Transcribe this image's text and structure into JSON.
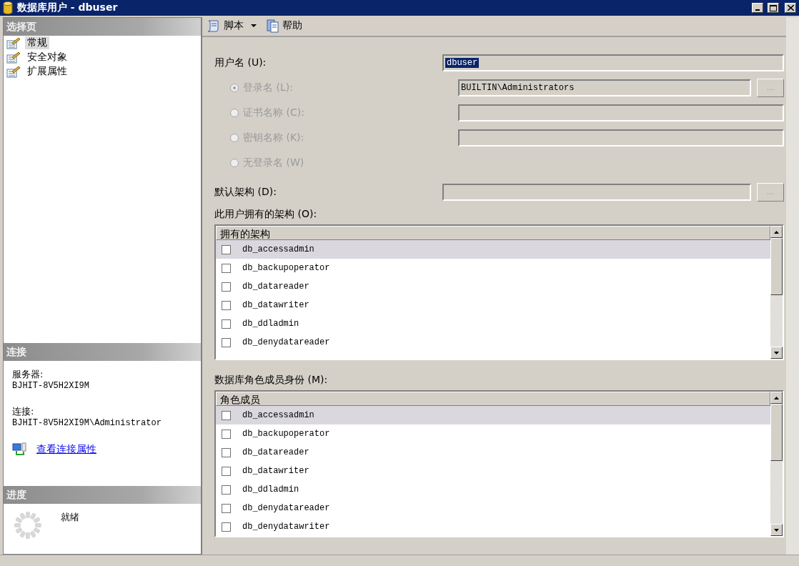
{
  "window": {
    "title": "数据库用户 - dbuser"
  },
  "sidebar": {
    "header": "选择页",
    "items": [
      {
        "label": "常规",
        "selected": true
      },
      {
        "label": "安全对象",
        "selected": false
      },
      {
        "label": "扩展属性",
        "selected": false
      }
    ]
  },
  "connection": {
    "header": "连接",
    "server_label": "服务器:",
    "server": "BJHIT-8V5H2XI9M",
    "connection_label": "连接:",
    "connection": "BJHIT-8V5H2XI9M\\Administrator",
    "link": "查看连接属性"
  },
  "progress": {
    "header": "进度",
    "status": "就绪"
  },
  "toolbar": [
    {
      "label": "脚本",
      "kind": "dropdown"
    },
    {
      "label": "帮助",
      "kind": "plain"
    }
  ],
  "form": {
    "user_name_label": "用户名 (U):",
    "user_name": "dbuser",
    "login_options": [
      {
        "label": "登录名 (L):",
        "kind": "field",
        "selected": true,
        "disabled": true,
        "value": "BUILTIN\\Administrators",
        "browse": "..."
      },
      {
        "label": "证书名称 (C):",
        "kind": "field",
        "selected": false,
        "disabled": true
      },
      {
        "label": "密钥名称 (K):",
        "kind": "field",
        "selected": false,
        "disabled": true
      },
      {
        "label": "无登录名 (W)",
        "kind": "plain",
        "selected": false,
        "disabled": true
      }
    ],
    "default_schema_label": "默认架构 (D):",
    "default_schema_browse": "..."
  },
  "owned_schemas": {
    "label": "此用户拥有的架构 (O):",
    "column": "拥有的架构",
    "rows": [
      {
        "name": "db_accessadmin",
        "checked": false,
        "selected": true
      },
      {
        "name": "db_backupoperator",
        "checked": false,
        "selected": false
      },
      {
        "name": "db_datareader",
        "checked": false,
        "selected": false
      },
      {
        "name": "db_datawriter",
        "checked": false,
        "selected": false
      },
      {
        "name": "db_ddladmin",
        "checked": false,
        "selected": false
      },
      {
        "name": "db_denydatareader",
        "checked": false,
        "selected": false
      }
    ]
  },
  "role_membership": {
    "label": "数据库角色成员身份 (M):",
    "column": "角色成员",
    "rows": [
      {
        "name": "db_accessadmin",
        "checked": false,
        "selected": true
      },
      {
        "name": "db_backupoperator",
        "checked": false,
        "selected": false
      },
      {
        "name": "db_datareader",
        "checked": false,
        "selected": false
      },
      {
        "name": "db_datawriter",
        "checked": false,
        "selected": false
      },
      {
        "name": "db_ddladmin",
        "checked": false,
        "selected": false
      },
      {
        "name": "db_denydatareader",
        "checked": false,
        "selected": false
      },
      {
        "name": "db_denydatawriter",
        "checked": false,
        "selected": false
      }
    ]
  }
}
